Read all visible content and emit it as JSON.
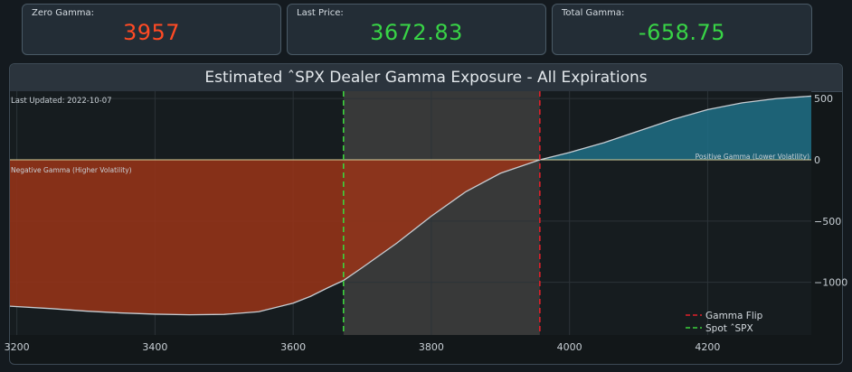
{
  "cards": [
    {
      "label": "Zero Gamma:",
      "value": "3957",
      "color": "#ff4a24"
    },
    {
      "label": "Last Price:",
      "value": "3672.83",
      "color": "#38d446"
    },
    {
      "label": "Total Gamma:",
      "value": "-658.75",
      "color": "#38d446"
    }
  ],
  "panel": {
    "title": "Estimated ˆSPX Dealer Gamma Exposure - All Expirations"
  },
  "chart_data": {
    "type": "area",
    "title": "Estimated ˆSPX Dealer Gamma Exposure - All Expirations",
    "xlabel": "",
    "ylabel": "",
    "xlim": [
      3190,
      4350
    ],
    "ylim": [
      -1430,
      560
    ],
    "x_ticks": [
      3200,
      3400,
      3600,
      3800,
      4000,
      4200
    ],
    "x_tick_labels": [
      "3200",
      "3400",
      "3600",
      "3800",
      "4000",
      "4200"
    ],
    "y_ticks": [
      500,
      0,
      -500,
      -1000
    ],
    "y_tick_labels": [
      "500",
      "0",
      "−500",
      "−1000"
    ],
    "grid": true,
    "legend_position": "bottom-right",
    "series": [
      {
        "name": "Gamma Exposure",
        "x": [
          3190,
          3250,
          3300,
          3350,
          3400,
          3450,
          3500,
          3550,
          3600,
          3625,
          3650,
          3672.83,
          3700,
          3750,
          3800,
          3850,
          3900,
          3957,
          4000,
          4050,
          4100,
          4150,
          4200,
          4250,
          4300,
          4350
        ],
        "y": [
          -1195,
          -1215,
          -1235,
          -1250,
          -1260,
          -1265,
          -1262,
          -1240,
          -1170,
          -1115,
          -1045,
          -985,
          -880,
          -680,
          -460,
          -260,
          -110,
          0,
          60,
          140,
          235,
          330,
          410,
          465,
          500,
          520
        ]
      }
    ],
    "vlines": [
      {
        "name": "Gamma Flip",
        "x": 3957,
        "color": "#e0202a"
      },
      {
        "name": "Spot ˆSPX",
        "x": 3672.83,
        "color": "#3cd23c"
      }
    ],
    "shaded_region": {
      "x": [
        3672.83,
        3957
      ]
    },
    "positive_fill_color": "#1f6f86",
    "negative_fill_color": "#9a3417",
    "annotations": [
      {
        "text": "Last Updated: 2022-10-07",
        "position": "top-left"
      },
      {
        "text": "Negative Gamma (Higher Volatility)",
        "position": "left-below-zero"
      },
      {
        "text": "Positive Gamma (Lower Volatility)",
        "position": "right-above-zero"
      }
    ]
  }
}
